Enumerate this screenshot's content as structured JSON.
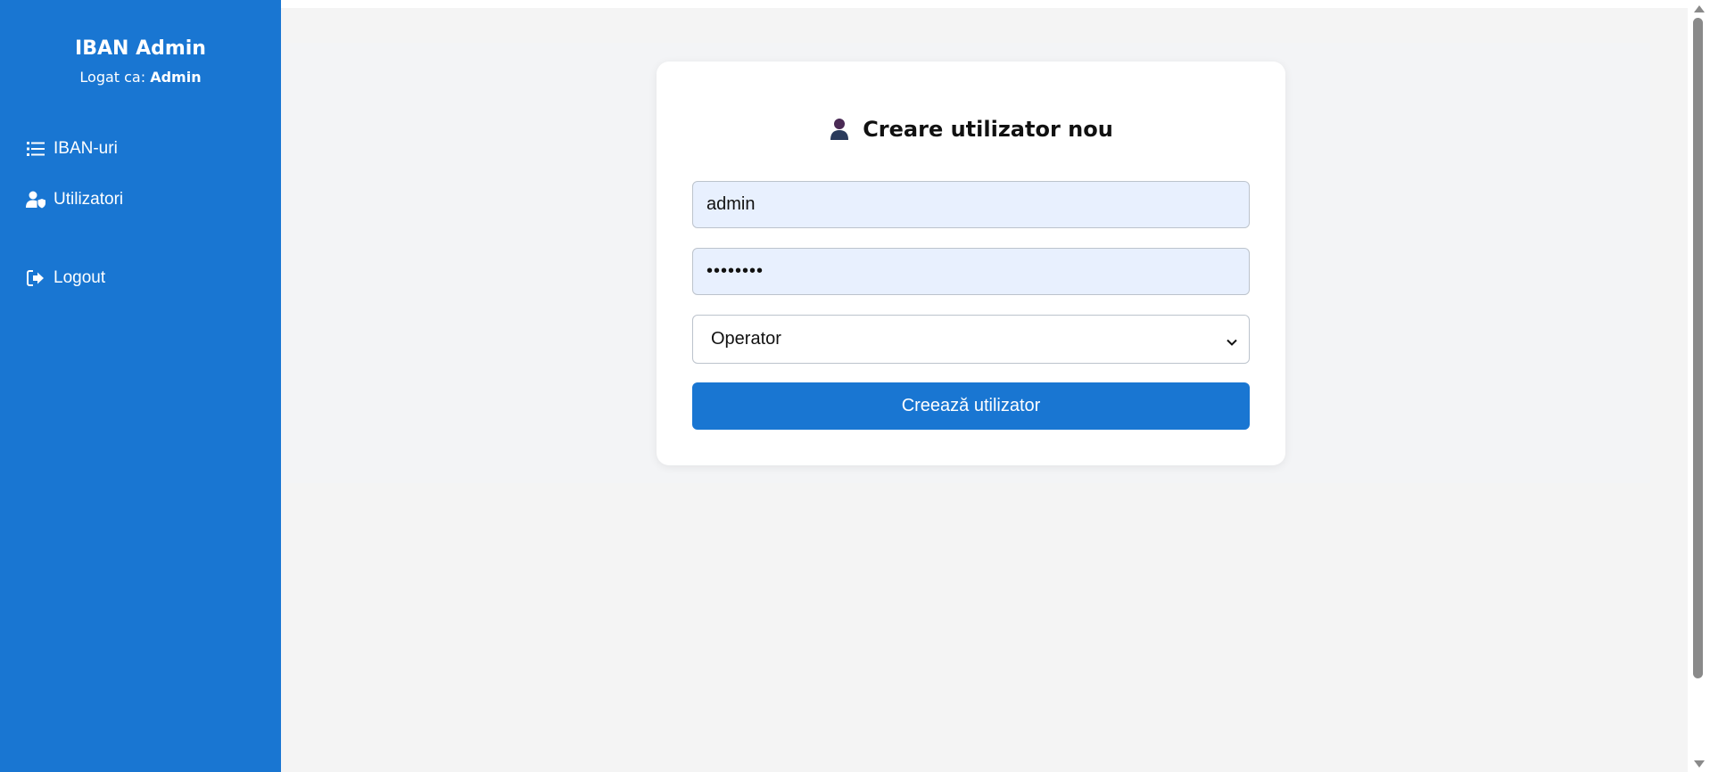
{
  "sidebar": {
    "brand": "IBAN Admin",
    "logged_prefix": "Logat ca:",
    "logged_user": "Admin",
    "items": [
      {
        "label": "IBAN-uri",
        "icon": "list-icon"
      },
      {
        "label": "Utilizatori",
        "icon": "user-shield-icon"
      },
      {
        "label": "Logout",
        "icon": "logout-icon"
      }
    ]
  },
  "form": {
    "title": "Creare utilizator nou",
    "title_icon": "user-icon",
    "username_value": "admin",
    "password_value": "••••••••",
    "role_selected": "Operator",
    "submit_label": "Creează utilizator"
  },
  "colors": {
    "sidebar": "#1976d2",
    "button": "#1976d2",
    "autofill_bg": "#e8f0fe",
    "page_bg": "#f4f4f4"
  }
}
